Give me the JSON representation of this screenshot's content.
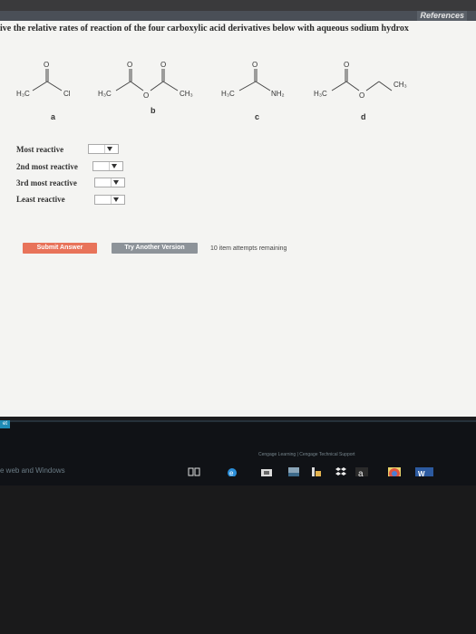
{
  "header": {
    "references_label": "References"
  },
  "question": {
    "prompt": "ive the relative rates of reaction of the four carboxylic acid derivatives below with aqueous sodium hydrox"
  },
  "structures": {
    "a": {
      "letter": "a",
      "left_group": "H₃C",
      "right_group": "Cl",
      "carbonyl_o": "O"
    },
    "b": {
      "letter": "b",
      "left_group": "H₃C",
      "bridge_o": "O",
      "right_group": "CH₃",
      "carbonyl_o": "O"
    },
    "c": {
      "letter": "c",
      "left_group": "H₃C",
      "right_group": "NH₂",
      "carbonyl_o": "O"
    },
    "d": {
      "letter": "d",
      "left_group": "H₃C",
      "bridge_o": "O",
      "right_group": "CH₃",
      "carbonyl_o": "O"
    }
  },
  "ranking": [
    {
      "label": "Most reactive",
      "selected": ""
    },
    {
      "label": "2nd most reactive",
      "selected": ""
    },
    {
      "label": "3rd most reactive",
      "selected": ""
    },
    {
      "label": "Least reactive",
      "selected": ""
    }
  ],
  "buttons": {
    "submit": "Submit Answer",
    "try_another": "Try Another Version"
  },
  "attempts_text": "10 item attempts remaining",
  "taskbar": {
    "search_text": "e web and Windows",
    "corner_tag": "et",
    "cengage_text": "Cengage Learning  |  Cengage Technical Support"
  }
}
